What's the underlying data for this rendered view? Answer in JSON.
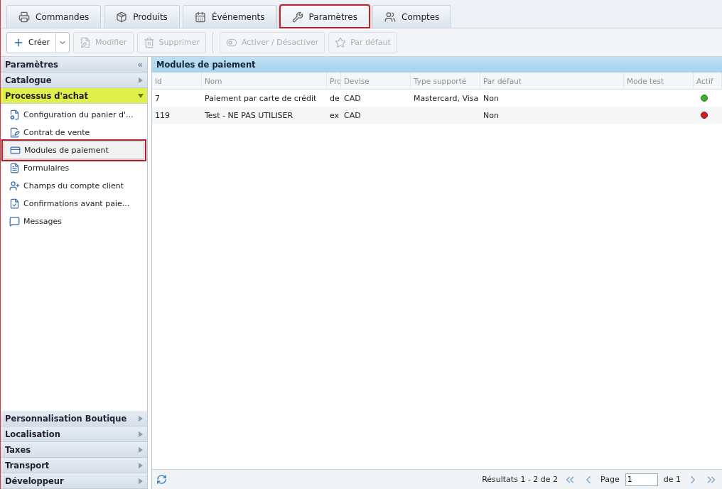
{
  "tabs": [
    {
      "label": "Commandes",
      "selected": false
    },
    {
      "label": "Produits",
      "selected": false
    },
    {
      "label": "Événements",
      "selected": false
    },
    {
      "label": "Paramètres",
      "selected": true
    },
    {
      "label": "Comptes",
      "selected": false
    }
  ],
  "toolbar": [
    {
      "label": "Créer",
      "disabled": false,
      "kind": "split"
    },
    {
      "label": "Modifier",
      "disabled": true,
      "kind": "button"
    },
    {
      "label": "Supprimer",
      "disabled": true,
      "kind": "button"
    },
    {
      "label": "Activer / Désactiver",
      "disabled": true,
      "kind": "button"
    },
    {
      "label": "Par défaut",
      "disabled": true,
      "kind": "button"
    }
  ],
  "sidebar": {
    "title": "Paramètres",
    "collapse_icon": "«",
    "sections": [
      {
        "label": "Catalogue",
        "expanded": false
      },
      {
        "label": "Processus d'achat",
        "expanded": true,
        "items": [
          {
            "label": "Configuration du panier d'...",
            "selected": false
          },
          {
            "label": "Contrat de vente",
            "selected": false
          },
          {
            "label": "Modules de paiement",
            "selected": true
          },
          {
            "label": "Formulaires",
            "selected": false
          },
          {
            "label": "Champs du compte client",
            "selected": false
          },
          {
            "label": "Confirmations avant paie...",
            "selected": false
          },
          {
            "label": "Messages",
            "selected": false
          }
        ]
      },
      {
        "label": "Personnalisation Boutique",
        "expanded": false
      },
      {
        "label": "Localisation",
        "expanded": false
      },
      {
        "label": "Taxes",
        "expanded": false
      },
      {
        "label": "Transport",
        "expanded": false
      },
      {
        "label": "Développeur",
        "expanded": false
      }
    ]
  },
  "panel": {
    "title": "Modules de paiement",
    "columns": [
      "Id",
      "Nom",
      "Pro",
      "Devise",
      "Type supporté",
      "Par défaut",
      "Mode test",
      "Actif"
    ],
    "rows": [
      {
        "cells": [
          "7",
          "Paiement par carte de crédit",
          "de",
          "CAD",
          "Mastercard, Visa",
          "Non",
          ""
        ],
        "active": true
      },
      {
        "cells": [
          "119",
          "Test - NE PAS UTILISER",
          "ex",
          "CAD",
          "",
          "Non",
          ""
        ],
        "active": false
      }
    ],
    "footer": {
      "results": "Résultats 1 - 2 de 2",
      "page_label": "Page",
      "page_value": "1",
      "page_total": "de 1"
    }
  }
}
